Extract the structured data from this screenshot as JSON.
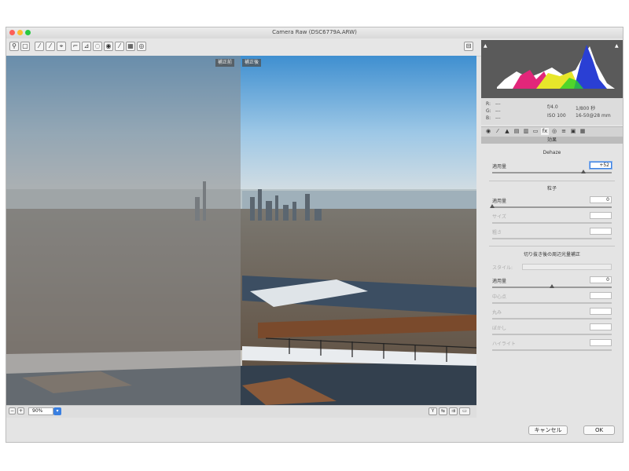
{
  "window": {
    "title": "Camera Raw (DSC6779A.ARW)",
    "traffic_colors": [
      "#fd5f57",
      "#fdbc2e",
      "#28c840"
    ]
  },
  "toolbar": {
    "tools": [
      {
        "icon": "zoom-tool-icon",
        "glyph": "⚲"
      },
      {
        "icon": "hand-tool-icon",
        "glyph": "▢"
      },
      {
        "icon": "white-balance-tool-icon",
        "glyph": "⁄"
      },
      {
        "icon": "color-sampler-tool-icon",
        "glyph": "⁄"
      },
      {
        "icon": "targeted-adjust-tool-icon",
        "glyph": "⌖"
      },
      {
        "icon": "crop-tool-icon",
        "glyph": "⌐"
      },
      {
        "icon": "straighten-tool-icon",
        "glyph": "⊿"
      },
      {
        "icon": "spot-removal-tool-icon",
        "glyph": "◌"
      },
      {
        "icon": "red-eye-tool-icon",
        "glyph": "◉"
      },
      {
        "icon": "adjustment-brush-icon",
        "glyph": "⁄"
      },
      {
        "icon": "graduated-filter-icon",
        "glyph": "▦"
      },
      {
        "icon": "radial-filter-icon",
        "glyph": "◎"
      }
    ],
    "preferences_glyph": "⊟"
  },
  "preview": {
    "before_label": "補正前",
    "after_label": "補正後"
  },
  "bottom": {
    "zoom": "90%"
  },
  "info": {
    "r_label": "R:",
    "g_label": "G:",
    "b_label": "B:",
    "rgb_value": "---",
    "aperture": "f/4.0",
    "shutter": "1/800 秒",
    "iso": "ISO 100",
    "lens": "16-50@28 mm"
  },
  "panel": {
    "section_title": "効果",
    "dehaze_group": "Dehaze",
    "dehaze_amount_label": "適用量",
    "dehaze_amount": "+52",
    "dehaze_amount_value": 52,
    "grain_group": "粒子",
    "grain_amount_label": "適用量",
    "grain_amount": "0",
    "grain_size_label": "サイズ",
    "grain_roughness_label": "粗さ",
    "vignette_group": "切り抜き後の周辺光量補正",
    "vignette_style_label": "スタイル:",
    "vignette_amount_label": "適用量",
    "vignette_amount": "0",
    "vignette_midpoint_label": "中心点",
    "vignette_roundness_label": "丸み",
    "vignette_feather_label": "ぼかし",
    "vignette_highlights_label": "ハイライト"
  },
  "buttons": {
    "cancel": "キャンセル",
    "ok": "OK"
  }
}
